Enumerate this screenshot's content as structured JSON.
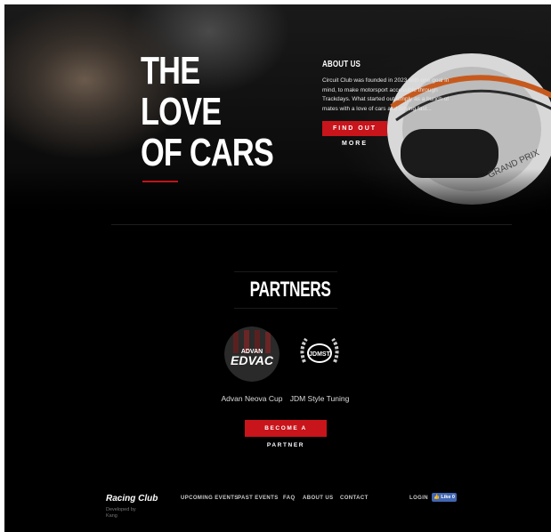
{
  "hero": {
    "title_lines": [
      "THE",
      "LOVE",
      "OF CARS"
    ],
    "about_heading": "ABOUT US",
    "about_text": "Circuit Club was founded in 2023 with one goal in mind, to make motorsport accessible through Trackdays. What started out simply as a bunch of mates with a love of cars and driving fast...",
    "cta_label": "FIND OUT MORE",
    "helmet_text": "GRAND PRIX"
  },
  "partners": {
    "title": "PARTNERS",
    "items": [
      {
        "name": "Advan Neova Cup",
        "logo_text": "ADVAN",
        "logo_big": "EDVAC"
      },
      {
        "name": "JDM Style Tuning",
        "logo_text": "JDMST"
      }
    ],
    "cta_label": "BECOME A PARTNER"
  },
  "footer": {
    "brand": "Racing Club",
    "developed_by": "Developed by",
    "developer": "Kang",
    "nav": [
      "UPCOMING EVENTS",
      "PAST EVENTS",
      "FAQ",
      "ABOUT US",
      "CONTACT"
    ],
    "login": "LOGIN",
    "like": "Like 0"
  },
  "colors": {
    "accent": "#c8141b",
    "background": "#000000",
    "facebook": "#4267b2"
  }
}
